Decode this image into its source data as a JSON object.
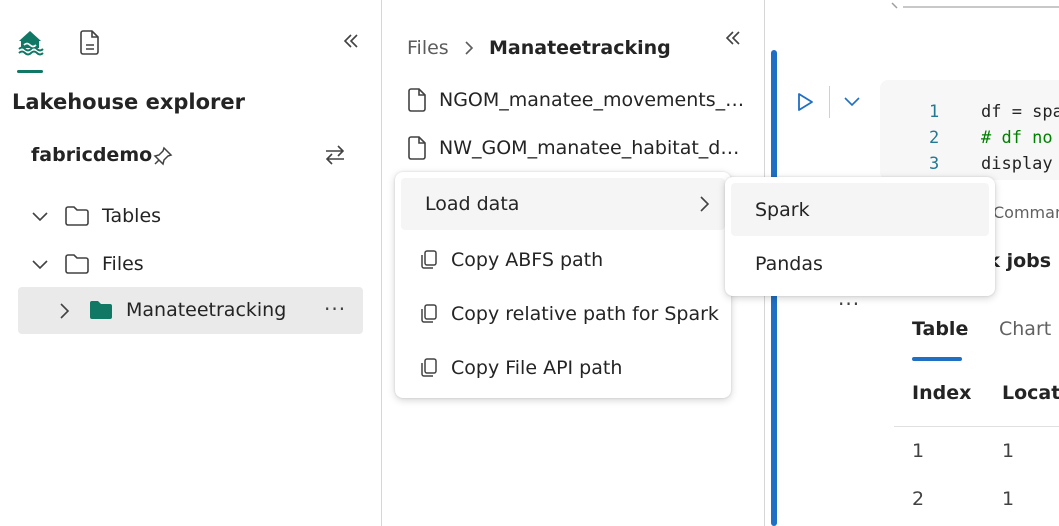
{
  "left_panel": {
    "title": "Lakehouse explorer",
    "lakehouse_name": "fabricdemo",
    "tree": [
      {
        "label": "Tables"
      },
      {
        "label": "Files"
      },
      {
        "label": "Manateetracking"
      }
    ],
    "more_label": "···"
  },
  "middle_panel": {
    "breadcrumb": {
      "root": "Files",
      "separator": "›",
      "current": "Manateetracking"
    },
    "files": [
      {
        "label": "NGOM_manatee_movements_r..."
      },
      {
        "label": "NW_GOM_manatee_habitat_da..."
      }
    ]
  },
  "context_menu": {
    "items": [
      {
        "label": "Load data"
      },
      {
        "label": "Copy ABFS path"
      },
      {
        "label": "Copy relative path for Spark"
      },
      {
        "label": "Copy File API path"
      }
    ],
    "submenu": [
      {
        "label": "Spark"
      },
      {
        "label": "Pandas"
      }
    ]
  },
  "notebook": {
    "code_lines": [
      {
        "num": "1",
        "text": "df = spa"
      },
      {
        "num": "2",
        "text": "# df no"
      },
      {
        "num": "3",
        "text": "display"
      }
    ],
    "command_label": "Comman",
    "jobs_label": "rk jobs",
    "more_label": "···",
    "tabs": {
      "table": "Table",
      "chart": "Chart"
    },
    "columns": {
      "index": "Index",
      "location": "Locati"
    },
    "rows": [
      {
        "index": "1",
        "location": "1"
      },
      {
        "index": "2",
        "location": "1"
      }
    ]
  },
  "colors": {
    "accent_teal": "#117865",
    "accent_blue": "#1f6fc4"
  }
}
